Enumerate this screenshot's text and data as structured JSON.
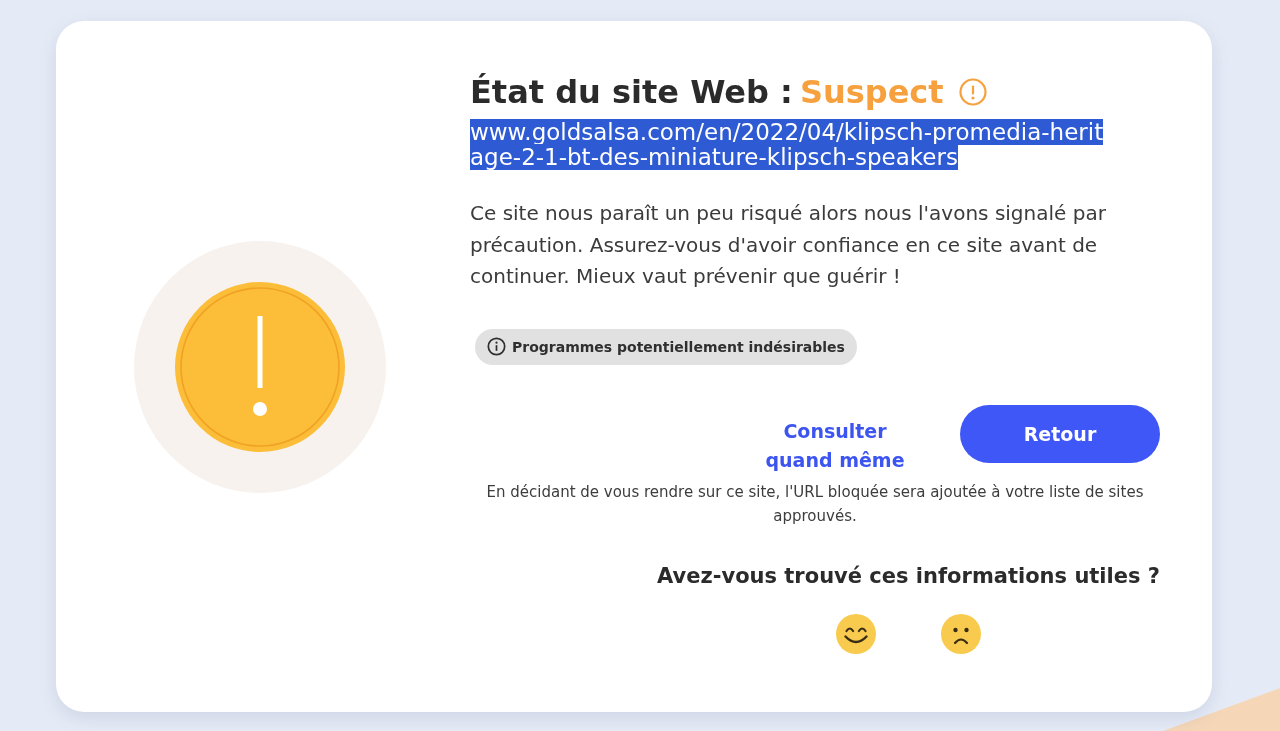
{
  "status": {
    "label": "État du site Web :",
    "value": "Suspect",
    "kind": "suspect"
  },
  "url": {
    "text": "www.goldsalsa.com/en/2022/04/klipsch-promedia-heritage-2-1-bt-des-miniature-klipsch-speakers",
    "highlighted": true
  },
  "description": "Ce site nous paraît un peu risqué alors nous l'avons signalé par précaution. Assurez-vous d'avoir confiance en ce site avant de continuer. Mieux vaut prévenir que guérir !",
  "tags": [
    {
      "label": "Programmes potentiellement indésirables"
    }
  ],
  "actions": [
    {
      "kind": "link",
      "label": "Consulter quand même"
    },
    {
      "kind": "primary",
      "label": "Retour"
    }
  ],
  "note": "En décidant de vous rendre sur ce site, l'URL bloquée sera ajoutée à votre liste de sites approuvés.",
  "feedback": {
    "question": "Avez-vous trouvé ces informations utiles ?",
    "options": [
      {
        "kind": "positive"
      },
      {
        "kind": "negative"
      }
    ]
  }
}
